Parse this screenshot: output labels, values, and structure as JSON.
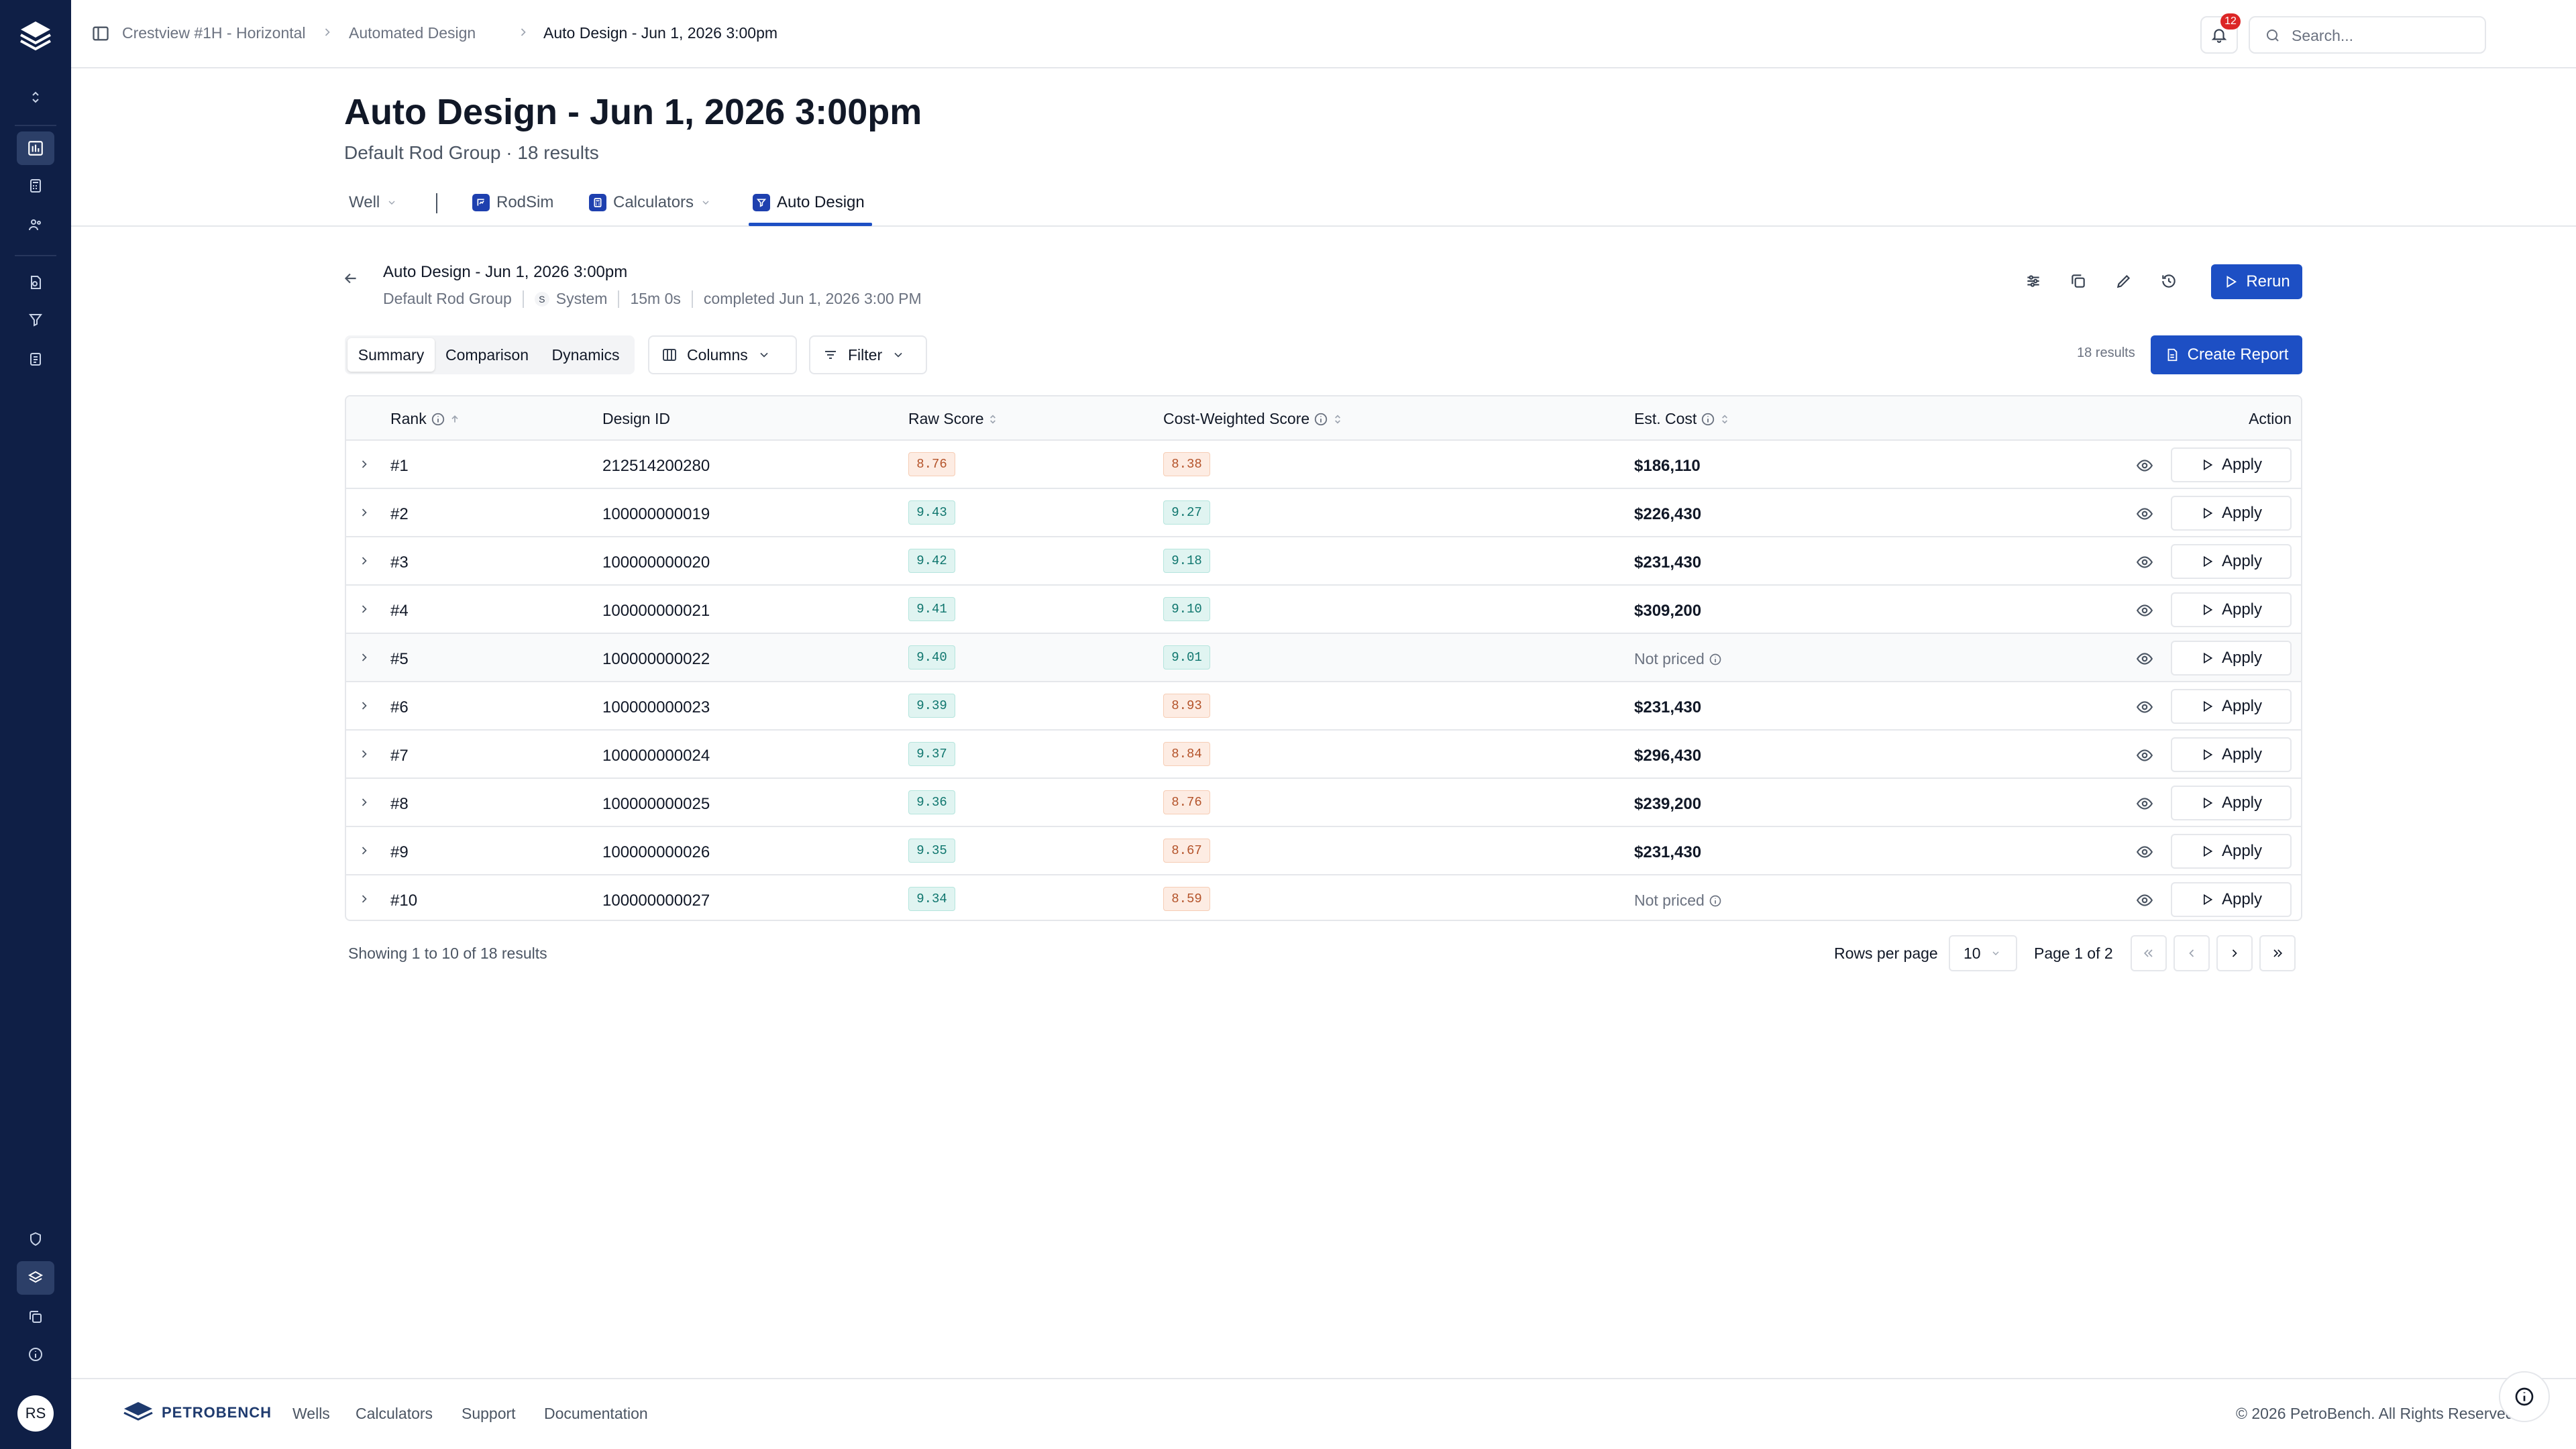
{
  "breadcrumb": [
    "Crestview #1H - Horizontal",
    "Automated Design",
    "Auto Design - Jun 1, 2026 3:00pm"
  ],
  "notifications": {
    "count": "12"
  },
  "search": {
    "placeholder": "Search..."
  },
  "header": {
    "title": "Auto Design - Jun 1, 2026 3:00pm",
    "subtitle": "Default Rod Group · 18 results"
  },
  "tabs": {
    "well": "Well",
    "rodsim": "RodSim",
    "calculators": "Calculators",
    "auto_design": "Auto Design"
  },
  "run": {
    "title": "Auto Design - Jun 1, 2026 3:00pm",
    "group": "Default Rod Group",
    "user_initial": "S",
    "user": "System",
    "duration": "15m 0s",
    "completed": "completed Jun 1, 2026 3:00 PM",
    "rerun_label": "Rerun"
  },
  "toolbar": {
    "views": [
      "Summary",
      "Comparison",
      "Dynamics"
    ],
    "active_view": "Summary",
    "columns_label": "Columns",
    "filter_label": "Filter",
    "results_count": "18 results",
    "create_report_label": "Create Report"
  },
  "table": {
    "columns": {
      "rank": "Rank",
      "design_id": "Design ID",
      "raw_score": "Raw Score",
      "cost_weighted": "Cost-Weighted Score",
      "est_cost": "Est. Cost",
      "action": "Action"
    },
    "apply_label": "Apply",
    "rows": [
      {
        "rank": "#1",
        "design_id": "212514200280",
        "raw": "8.76",
        "raw_tone": "orange",
        "cw": "8.38",
        "cw_tone": "orange",
        "cost": "$186,110"
      },
      {
        "rank": "#2",
        "design_id": "100000000019",
        "raw": "9.43",
        "raw_tone": "green",
        "cw": "9.27",
        "cw_tone": "green",
        "cost": "$226,430"
      },
      {
        "rank": "#3",
        "design_id": "100000000020",
        "raw": "9.42",
        "raw_tone": "green",
        "cw": "9.18",
        "cw_tone": "green",
        "cost": "$231,430"
      },
      {
        "rank": "#4",
        "design_id": "100000000021",
        "raw": "9.41",
        "raw_tone": "green",
        "cw": "9.10",
        "cw_tone": "green",
        "cost": "$309,200"
      },
      {
        "rank": "#5",
        "design_id": "100000000022",
        "raw": "9.40",
        "raw_tone": "green",
        "cw": "9.01",
        "cw_tone": "green",
        "cost": "Not priced"
      },
      {
        "rank": "#6",
        "design_id": "100000000023",
        "raw": "9.39",
        "raw_tone": "green",
        "cw": "8.93",
        "cw_tone": "orange",
        "cost": "$231,430"
      },
      {
        "rank": "#7",
        "design_id": "100000000024",
        "raw": "9.37",
        "raw_tone": "green",
        "cw": "8.84",
        "cw_tone": "orange",
        "cost": "$296,430"
      },
      {
        "rank": "#8",
        "design_id": "100000000025",
        "raw": "9.36",
        "raw_tone": "green",
        "cw": "8.76",
        "cw_tone": "orange",
        "cost": "$239,200"
      },
      {
        "rank": "#9",
        "design_id": "100000000026",
        "raw": "9.35",
        "raw_tone": "green",
        "cw": "8.67",
        "cw_tone": "orange",
        "cost": "$231,430"
      },
      {
        "rank": "#10",
        "design_id": "100000000027",
        "raw": "9.34",
        "raw_tone": "green",
        "cw": "8.59",
        "cw_tone": "orange",
        "cost": "Not priced"
      }
    ]
  },
  "pagination": {
    "showing": "Showing 1 to 10 of 18 results",
    "rows_per_page_label": "Rows per page",
    "rows_per_page": "10",
    "page": "Page 1 of 2"
  },
  "footer": {
    "brand": "PETROBENCH",
    "links": [
      "Wells",
      "Calculators",
      "Support",
      "Documentation"
    ],
    "copyright": "© 2026 PetroBench. All Rights Reserved."
  },
  "user": {
    "initials": "RS"
  },
  "colors": {
    "primary": "#1d4fc4",
    "sidebar": "#0f1f46",
    "score_green": "#0f766e",
    "score_orange": "#b4532a"
  }
}
